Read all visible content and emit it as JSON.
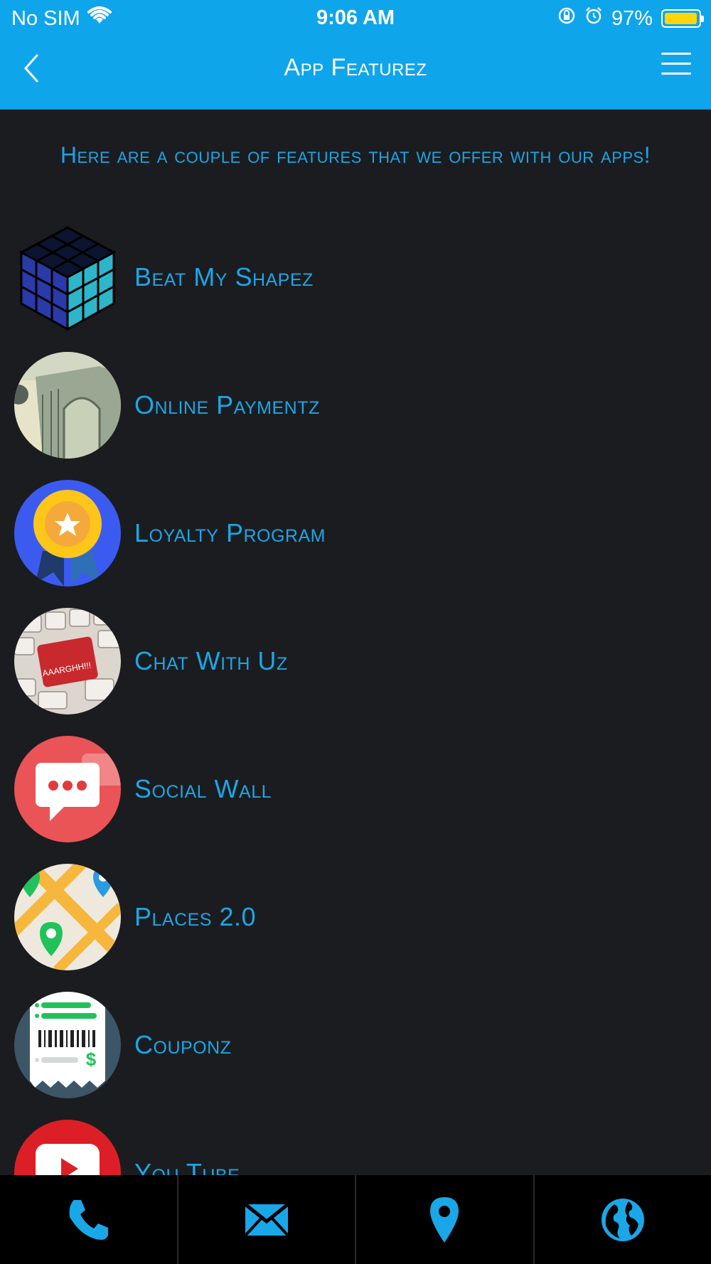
{
  "status_bar": {
    "carrier": "No SIM",
    "time": "9:06 AM",
    "battery_percent": "97%",
    "battery_level": 0.97,
    "icons": [
      "wifi-icon",
      "orientation-lock-icon",
      "alarm-icon",
      "battery-icon"
    ]
  },
  "header": {
    "title": "App Featurez",
    "back_icon": "chevron-left-icon",
    "menu_icon": "hamburger-menu-icon",
    "background": "#0ea5eb"
  },
  "intro_text": "Here are a couple of features that we offer with our apps!",
  "features": [
    {
      "label": "Beat My Shapez",
      "icon": "rubiks-cube-icon"
    },
    {
      "label": "Online Paymentz",
      "icon": "banknote-icon"
    },
    {
      "label": "Loyalty Program",
      "icon": "award-badge-icon"
    },
    {
      "label": "Chat With Uz",
      "icon": "keyboard-icon"
    },
    {
      "label": "Social Wall",
      "icon": "chat-bubble-icon"
    },
    {
      "label": "Places 2.0",
      "icon": "map-pin-icon"
    },
    {
      "label": "Couponz",
      "icon": "receipt-icon"
    },
    {
      "label": "You Tube",
      "icon": "youtube-play-icon"
    }
  ],
  "tab_bar": {
    "tabs": [
      {
        "name": "phone",
        "icon": "phone-icon"
      },
      {
        "name": "email",
        "icon": "envelope-icon"
      },
      {
        "name": "location",
        "icon": "location-pin-icon"
      },
      {
        "name": "web",
        "icon": "globe-icon"
      }
    ],
    "icon_color": "#1aa7e8"
  },
  "colors": {
    "accent": "#1aa7e8",
    "background": "#1b1c1f",
    "tab_background": "#000000"
  }
}
